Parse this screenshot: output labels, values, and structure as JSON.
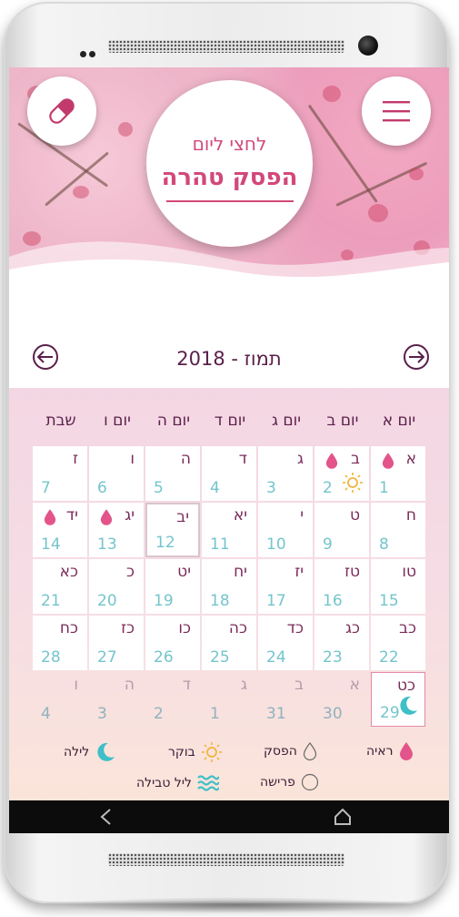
{
  "header": {
    "subtitle": "לחצי ליום",
    "title": "הפסק טהרה",
    "menu_icon": "hamburger-icon",
    "pill_icon": "pill-icon"
  },
  "calendar": {
    "month_title": "תמוז - 2018",
    "weekdays": [
      "יום א",
      "יום ב",
      "יום ג",
      "יום ד",
      "יום ה",
      "יום ו",
      "שבת"
    ],
    "weeks": [
      [
        {
          "heb": "א",
          "greg": "1",
          "icons": [
            "drop"
          ]
        },
        {
          "heb": "ב",
          "greg": "2",
          "icons": [
            "drop",
            "sun"
          ]
        },
        {
          "heb": "ג",
          "greg": "3",
          "icons": []
        },
        {
          "heb": "ד",
          "greg": "4",
          "icons": []
        },
        {
          "heb": "ה",
          "greg": "5",
          "icons": []
        },
        {
          "heb": "ו",
          "greg": "6",
          "icons": []
        },
        {
          "heb": "ז",
          "greg": "7",
          "icons": []
        }
      ],
      [
        {
          "heb": "ח",
          "greg": "8",
          "icons": []
        },
        {
          "heb": "ט",
          "greg": "9",
          "icons": []
        },
        {
          "heb": "י",
          "greg": "10",
          "icons": []
        },
        {
          "heb": "יא",
          "greg": "11",
          "icons": []
        },
        {
          "heb": "יב",
          "greg": "12",
          "icons": [],
          "today": true
        },
        {
          "heb": "יג",
          "greg": "13",
          "icons": [
            "drop"
          ]
        },
        {
          "heb": "יד",
          "greg": "14",
          "icons": [
            "drop"
          ]
        }
      ],
      [
        {
          "heb": "טו",
          "greg": "15",
          "icons": []
        },
        {
          "heb": "טז",
          "greg": "16",
          "icons": []
        },
        {
          "heb": "יז",
          "greg": "17",
          "icons": []
        },
        {
          "heb": "יח",
          "greg": "18",
          "icons": []
        },
        {
          "heb": "יט",
          "greg": "19",
          "icons": []
        },
        {
          "heb": "כ",
          "greg": "20",
          "icons": []
        },
        {
          "heb": "כא",
          "greg": "21",
          "icons": []
        }
      ],
      [
        {
          "heb": "כב",
          "greg": "22",
          "icons": []
        },
        {
          "heb": "כג",
          "greg": "23",
          "icons": []
        },
        {
          "heb": "כד",
          "greg": "24",
          "icons": []
        },
        {
          "heb": "כה",
          "greg": "25",
          "icons": []
        },
        {
          "heb": "כו",
          "greg": "26",
          "icons": []
        },
        {
          "heb": "כז",
          "greg": "27",
          "icons": []
        },
        {
          "heb": "כח",
          "greg": "28",
          "icons": []
        }
      ],
      [
        {
          "heb": "כט",
          "greg": "29",
          "icons": [
            "moon"
          ],
          "selected": true
        },
        {
          "heb": "א",
          "greg": "30",
          "icons": [],
          "faded": true
        },
        {
          "heb": "ב",
          "greg": "31",
          "icons": [],
          "faded": true
        },
        {
          "heb": "ג",
          "greg": "1",
          "icons": [],
          "faded": true
        },
        {
          "heb": "ד",
          "greg": "2",
          "icons": [],
          "faded": true
        },
        {
          "heb": "ה",
          "greg": "3",
          "icons": [],
          "faded": true
        },
        {
          "heb": "ו",
          "greg": "4",
          "icons": [],
          "faded": true
        }
      ]
    ]
  },
  "legend": {
    "sighting": "ראיה",
    "hefsek": "הפסק",
    "morning": "בוקר",
    "night": "לילה",
    "separation": "פרישה",
    "immersion_night": "ליל טבילה"
  },
  "colors": {
    "accent": "#d2487b",
    "dark_text": "#5a1f4a",
    "greg_text": "#74c5cc",
    "drop": "#e3548a",
    "sun": "#f2b43c",
    "moon": "#3fbfc7"
  }
}
